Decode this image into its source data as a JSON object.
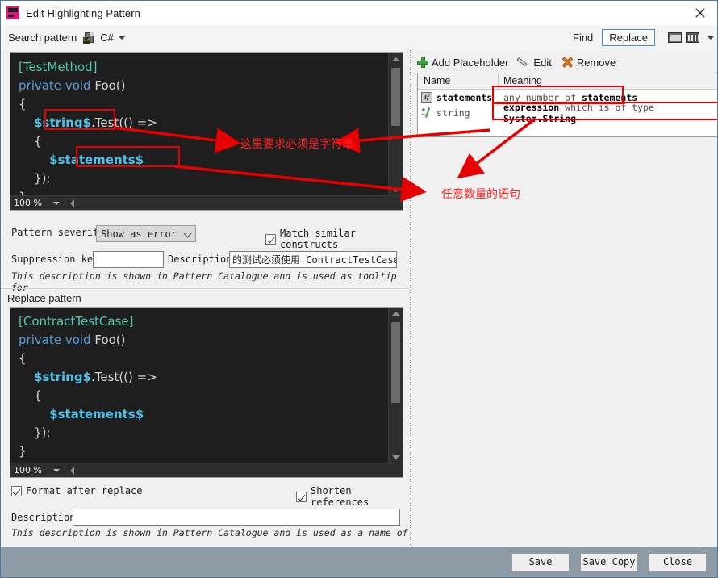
{
  "window": {
    "title": "Edit Highlighting Pattern",
    "app_icon": "resharper-icon",
    "close_icon": "close-icon"
  },
  "toolbar": {
    "search_pattern_label": "Search pattern",
    "language_icon": "csharp-file-icon",
    "language": "C#",
    "language_badge": "C#",
    "dropdown_icon": "chevron-down-icon",
    "find_tab": "Find",
    "replace_tab": "Replace",
    "active_tab": "Replace",
    "icon_button_1": "screenshot-icon",
    "icon_button_2": "filmstrip-icon",
    "icon_button_2_caret": "chevron-down-icon"
  },
  "search_editor": {
    "lines": [
      "[TestMethod]",
      "private void Foo()",
      "{",
      "    $string$.Test(() =>",
      "    {",
      "        $statements$",
      "    });",
      "}"
    ],
    "zoom": "100 %",
    "zoom_caret_icon": "chevron-down-icon",
    "scroll_up_icon": "triangle-up-icon",
    "scroll_down_icon": "triangle-down-icon"
  },
  "replace_section": {
    "label": "Replace pattern",
    "lines": [
      "[ContractTestCase]",
      "private void Foo()",
      "{",
      "    $string$.Test(() =>",
      "    {",
      "        $statements$",
      "    });",
      "}"
    ],
    "zoom": "100 %",
    "zoom_caret_icon": "chevron-down-icon"
  },
  "pattern_options": {
    "severity_label": "Pattern severity",
    "severity_value": "Show as error",
    "severity_caret_icon": "chevron-down-icon",
    "match_similar_label": "Match similar constructs",
    "match_similar_checked": true,
    "suppression_key_label": "Suppression key",
    "suppression_key_value": "",
    "description_label": "Description",
    "description_value": "的测试必须使用 ContractTestCase 特",
    "description_hint": "This description is shown in Pattern Catalogue and is used as tooltip for"
  },
  "replace_options": {
    "format_after_replace_label": "Format after replace",
    "format_after_replace_checked": true,
    "shorten_references_label": "Shorten references",
    "shorten_references_checked": true,
    "description_label": "Description",
    "description_value": "",
    "description_hint": "This description is shown in Pattern Catalogue and is used as a name of"
  },
  "placeholders": {
    "add_label": "Add Placeholder",
    "add_icon": "plus-icon",
    "edit_label": "Edit",
    "edit_icon": "pencil-icon",
    "remove_label": "Remove",
    "remove_icon": "x-icon",
    "columns": [
      "Name",
      "Meaning"
    ],
    "rows": [
      {
        "icon": "statement-placeholder-icon",
        "icon_text": "if",
        "name": "statements",
        "meaning_prefix": "any number of ",
        "meaning_bold": "statements"
      },
      {
        "icon": "expression-placeholder-icon",
        "name": "string",
        "meaning_bold_1": "expression",
        "meaning_mid": " which is of type ",
        "meaning_bold_2": "System.String"
      }
    ]
  },
  "annotations": {
    "note_string": "这里要求必须是字符串",
    "note_statements": "任意数量的语句",
    "color": "#e60000"
  },
  "footer": {
    "save_label": "Save",
    "save_copy_label": "Save Copy",
    "close_label": "Close"
  }
}
